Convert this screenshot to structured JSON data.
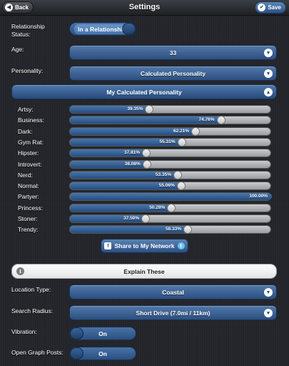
{
  "header": {
    "title": "Settings",
    "back_label": "Back",
    "save_label": "Save"
  },
  "relationship": {
    "label": "Relationship\nStatus:",
    "value": "In a Relationship"
  },
  "age": {
    "label": "Age:",
    "value": "33"
  },
  "personality": {
    "label": "Personality:",
    "value": "Calculated Personality"
  },
  "calculated": {
    "title": "My Calculated Personality"
  },
  "traits": [
    {
      "name": "Artsy:",
      "value": 39.35,
      "label": "39.35%"
    },
    {
      "name": "Business:",
      "value": 74.76,
      "label": "74.76%"
    },
    {
      "name": "Dark:",
      "value": 62.21,
      "label": "62.21%"
    },
    {
      "name": "Gym Rat:",
      "value": 55.31,
      "label": "55.31%"
    },
    {
      "name": "Hipster:",
      "value": 37.81,
      "label": "37.81%"
    },
    {
      "name": "Introvert:",
      "value": 38.08,
      "label": "38.08%"
    },
    {
      "name": "Nerd:",
      "value": 53.35,
      "label": "53.35%"
    },
    {
      "name": "Normal:",
      "value": 55.06,
      "label": "55.06%"
    },
    {
      "name": "Partyer:",
      "value": 100.0,
      "label": "100.00%"
    },
    {
      "name": "Princess:",
      "value": 50.28,
      "label": "50.28%"
    },
    {
      "name": "Stoner:",
      "value": 37.5,
      "label": "37.50%"
    },
    {
      "name": "Trendy:",
      "value": 58.33,
      "label": "58.33%"
    }
  ],
  "share": {
    "label": "Share to My Network"
  },
  "explain": {
    "label": "Explain These"
  },
  "location": {
    "label": "Location Type:",
    "value": "Coastal"
  },
  "radius": {
    "label": "Search Radius:",
    "value": "Short Drive (7.0mi / 11km)"
  },
  "vibration": {
    "label": "Vibration:",
    "value": "On"
  },
  "opengraph": {
    "label": "Open Graph Posts:",
    "value": "On"
  }
}
